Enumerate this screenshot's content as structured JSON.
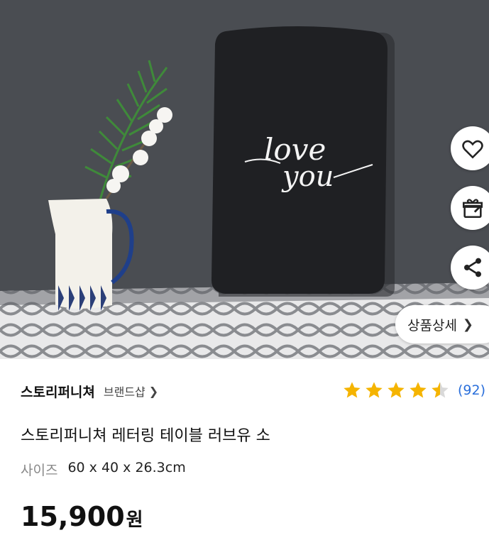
{
  "hero": {
    "board_text_line1": "love",
    "board_text_line2": "you",
    "detail_button_label": "상품상세"
  },
  "actions": {
    "wishlist": "heart-icon",
    "gift": "gift-icon",
    "share": "share-icon"
  },
  "product": {
    "brand": "스토리퍼니쳐",
    "brand_shop_label": "브랜드샵",
    "rating": 4.5,
    "review_count": "(92)",
    "title": "스토리퍼니쳐 레터링 테이블 러브유 소",
    "size_label": "사이즈",
    "size_value": "60 x 40 x 26.3cm",
    "price": "15,900",
    "price_unit": "원"
  },
  "colors": {
    "star": "#f5b400",
    "review_link": "#2a6fdb",
    "wall": "#4b4e53",
    "board": "#1f2023"
  }
}
